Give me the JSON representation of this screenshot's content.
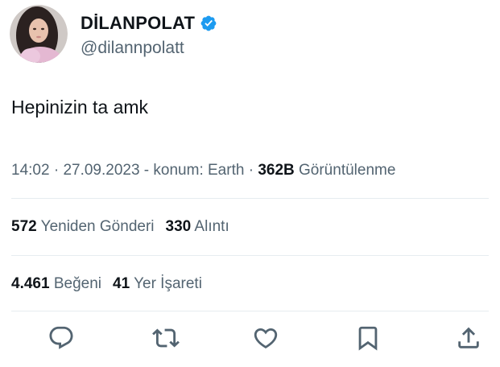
{
  "user": {
    "display_name": "DİLANPOLAT",
    "handle": "@dilannpolatt",
    "verified": true,
    "verified_color": "#1d9bf0"
  },
  "tweet": {
    "text": "Hepinizin ta amk"
  },
  "meta": {
    "time": "14:02",
    "sep1": " · ",
    "date": "27.09.2023",
    "sep2": " - ",
    "location": "konum: Earth",
    "sep3": " · ",
    "views_count": "362B",
    "views_label": " Görüntülenme"
  },
  "engagement": {
    "reposts_count": "572",
    "reposts_label": " Yeniden Gönderi",
    "quotes_count": "330",
    "quotes_label": " Alıntı",
    "likes_count": "4.461",
    "likes_label": " Beğeni",
    "bookmarks_count": "41",
    "bookmarks_label": " Yer İşareti"
  },
  "actions": [
    {
      "name": "reply",
      "icon": "comment-icon"
    },
    {
      "name": "repost",
      "icon": "retweet-icon"
    },
    {
      "name": "like",
      "icon": "heart-icon"
    },
    {
      "name": "bookmark",
      "icon": "bookmark-icon"
    },
    {
      "name": "share",
      "icon": "share-icon"
    }
  ],
  "colors": {
    "text_primary": "#0f1419",
    "text_secondary": "#536471",
    "divider": "#e6ecf0",
    "icon": "#536471"
  }
}
